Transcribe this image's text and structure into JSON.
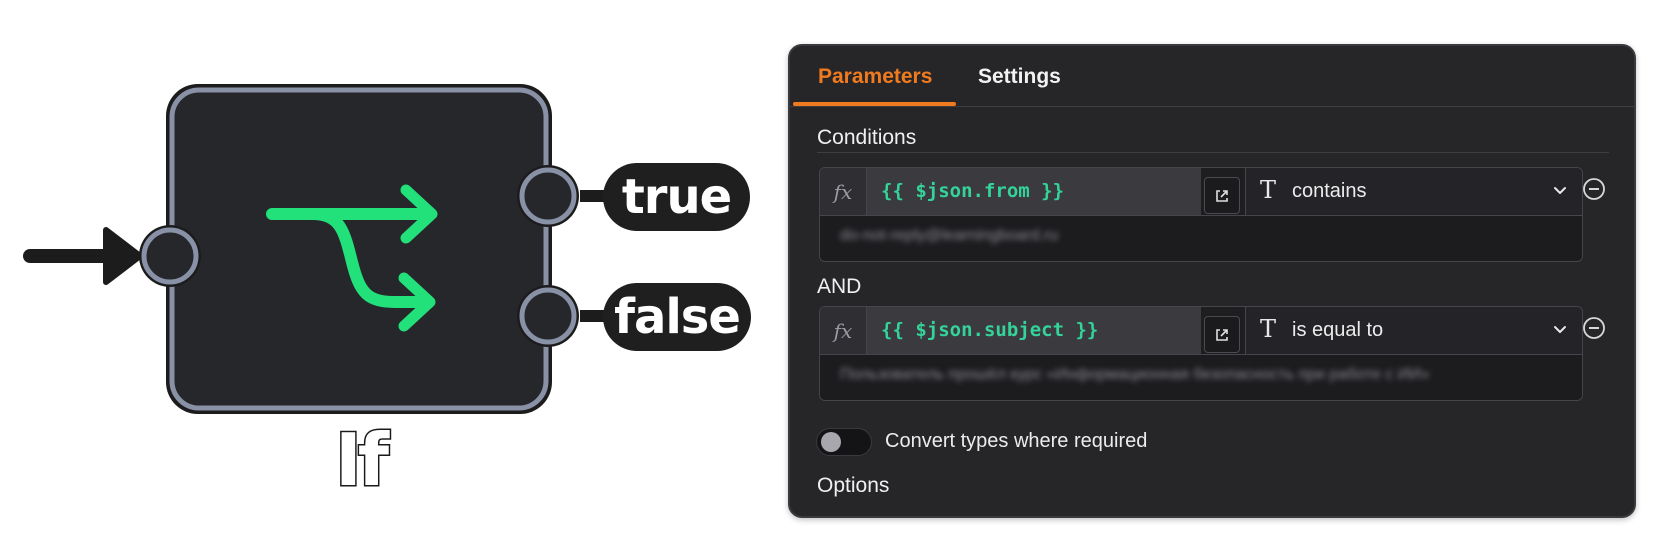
{
  "node": {
    "name": "If",
    "outputs": {
      "true_label": "true",
      "false_label": "false"
    },
    "icon": "branch-arrows-icon",
    "icon_color": "#22e07a"
  },
  "panel": {
    "tabs": [
      {
        "label": "Parameters",
        "active": true
      },
      {
        "label": "Settings",
        "active": false
      }
    ],
    "accent_color": "#f07a1e",
    "conditions_label": "Conditions",
    "combinator_label": "AND",
    "conditions": [
      {
        "fx_label": "fx",
        "expression": "{{ $json.from }}",
        "type_icon": "T",
        "operator": "contains",
        "value": "do-not-reply@learningboard.ru"
      },
      {
        "fx_label": "fx",
        "expression": "{{ $json.subject }}",
        "type_icon": "T",
        "operator": "is equal to",
        "value": "Пользователь прошёл курс «Информационная безопасность при работе с ИИ»"
      }
    ],
    "convert_types": {
      "label": "Convert types where required",
      "enabled": false
    },
    "options_label": "Options"
  }
}
